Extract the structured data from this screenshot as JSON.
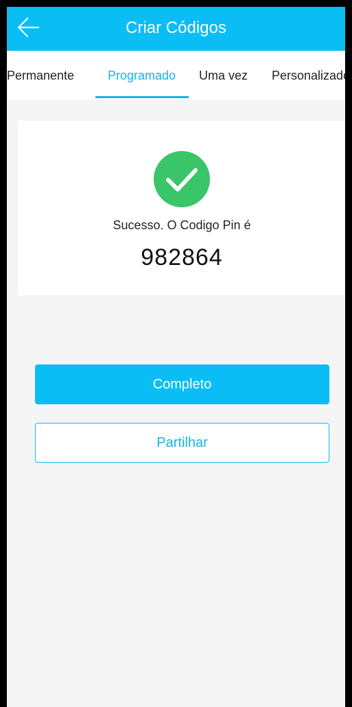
{
  "header": {
    "title": "Criar Códigos",
    "back_icon": "arrow-left-icon",
    "background": "#0abdf5"
  },
  "tabs": [
    {
      "label": "Permanente",
      "active": false
    },
    {
      "label": "Programado",
      "active": true
    },
    {
      "label": "Uma vez",
      "active": false
    },
    {
      "label": "Personalizado",
      "active": false
    }
  ],
  "result": {
    "icon": "check-circle-icon",
    "icon_color": "#3ac569",
    "message": "Sucesso. O Codigo Pin é",
    "pin": "982864"
  },
  "actions": {
    "complete_label": "Completo",
    "share_label": "Partilhar"
  },
  "colors": {
    "accent": "#0abdf5",
    "success": "#3ac569"
  }
}
